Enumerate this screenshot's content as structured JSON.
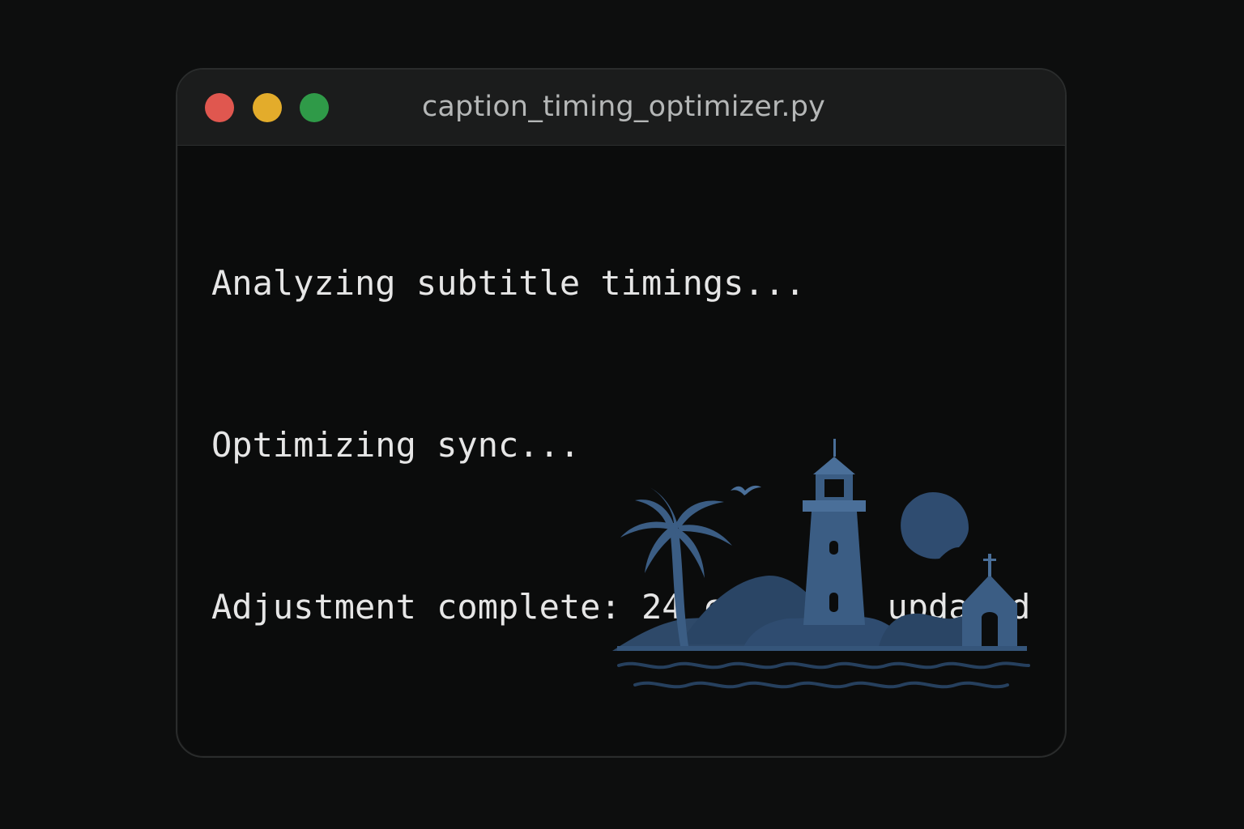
{
  "window": {
    "title": "caption_timing_optimizer.py",
    "controls": [
      {
        "name": "close",
        "color": "#e0574f"
      },
      {
        "name": "minimize",
        "color": "#e3ac2b"
      },
      {
        "name": "maximize",
        "color": "#2f9a48"
      }
    ]
  },
  "terminal": {
    "lines": [
      "Analyzing subtitle timings...",
      "Optimizing sync...",
      "Adjustment complete: 24 captions updated"
    ]
  },
  "illustration": {
    "name": "lighthouse-island-icon",
    "color": "#3a5a80"
  }
}
